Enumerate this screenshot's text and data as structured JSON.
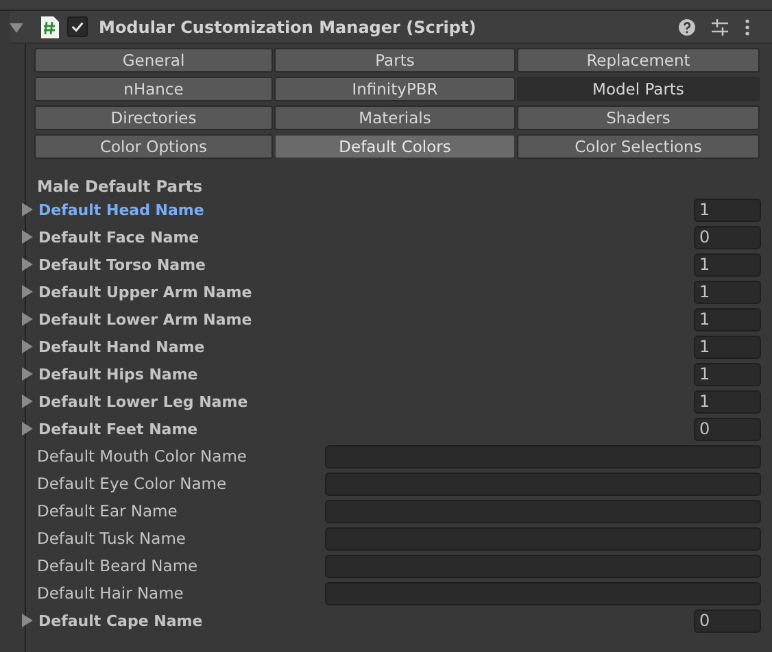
{
  "component": {
    "title": "Modular Customization Manager (Script)",
    "expanded": true,
    "enabled": true
  },
  "tabs": [
    {
      "label": "General",
      "selected": false,
      "pressed": false
    },
    {
      "label": "Parts",
      "selected": false,
      "pressed": false
    },
    {
      "label": "Replacement",
      "selected": false,
      "pressed": false
    },
    {
      "label": "nHance",
      "selected": false,
      "pressed": false
    },
    {
      "label": "InfinityPBR",
      "selected": false,
      "pressed": false
    },
    {
      "label": "Model Parts",
      "selected": false,
      "pressed": true
    },
    {
      "label": "Directories",
      "selected": false,
      "pressed": false
    },
    {
      "label": "Materials",
      "selected": false,
      "pressed": false
    },
    {
      "label": "Shaders",
      "selected": false,
      "pressed": false
    },
    {
      "label": "Color Options",
      "selected": false,
      "pressed": false
    },
    {
      "label": "Default Colors",
      "selected": true,
      "pressed": false
    },
    {
      "label": "Color Selections",
      "selected": false,
      "pressed": false
    }
  ],
  "section_title": "Male Default Parts",
  "fields": [
    {
      "kind": "array",
      "label": "Default Head Name",
      "value": "1",
      "highlighted": true
    },
    {
      "kind": "array",
      "label": "Default Face Name",
      "value": "0",
      "highlighted": false
    },
    {
      "kind": "array",
      "label": "Default Torso Name",
      "value": "1",
      "highlighted": false
    },
    {
      "kind": "array",
      "label": "Default Upper Arm Name",
      "value": "1",
      "highlighted": false
    },
    {
      "kind": "array",
      "label": "Default Lower Arm Name",
      "value": "1",
      "highlighted": false
    },
    {
      "kind": "array",
      "label": "Default Hand Name",
      "value": "1",
      "highlighted": false
    },
    {
      "kind": "array",
      "label": "Default Hips Name",
      "value": "1",
      "highlighted": false
    },
    {
      "kind": "array",
      "label": "Default Lower Leg Name",
      "value": "1",
      "highlighted": false
    },
    {
      "kind": "array",
      "label": "Default Feet Name",
      "value": "0",
      "highlighted": false
    },
    {
      "kind": "text",
      "label": "Default Mouth Color Name"
    },
    {
      "kind": "text",
      "label": "Default Eye Color Name"
    },
    {
      "kind": "text",
      "label": "Default Ear Name"
    },
    {
      "kind": "text",
      "label": "Default Tusk Name"
    },
    {
      "kind": "text",
      "label": "Default Beard Name"
    },
    {
      "kind": "text",
      "label": "Default Hair Name"
    },
    {
      "kind": "array",
      "label": "Default Cape Name",
      "value": "0",
      "highlighted": false
    }
  ]
}
